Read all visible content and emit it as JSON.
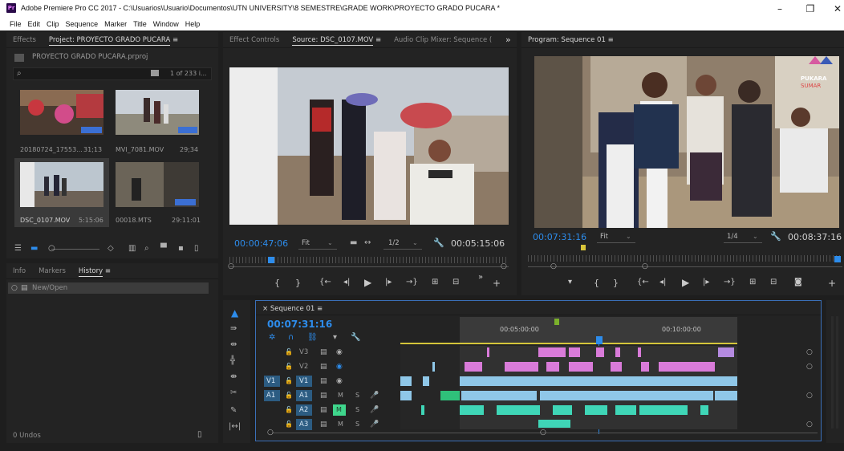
{
  "window": {
    "title": "Adobe Premiere Pro CC 2017 - C:\\Usuarios\\Usuario\\Documentos\\UTN UNIVERSITY\\8 SEMESTRE\\GRADE WORK\\PROYECTO GRADO PUCARA *",
    "app_icon": "Pr",
    "minimize": "–",
    "maximize": "❐",
    "close": "✕"
  },
  "menu": [
    "File",
    "Edit",
    "Clip",
    "Sequence",
    "Marker",
    "Title",
    "Window",
    "Help"
  ],
  "project_panel": {
    "tabs": [
      {
        "label": "Effects",
        "active": false
      },
      {
        "label": "Project: PROYECTO GRADO PUCARA",
        "active": true
      }
    ],
    "menu_icon": "≡",
    "project_file": "PROYECTO GRADO PUCARA.prproj",
    "search_placeholder": "",
    "item_count": "1 of 233 i...",
    "items": [
      {
        "name": "20180724_17553...",
        "duration": "31;13"
      },
      {
        "name": "MVI_7081.MOV",
        "duration": "29;34"
      },
      {
        "name": "DSC_0107.MOV",
        "duration": "5:15:06"
      },
      {
        "name": "00018.MTS",
        "duration": "29:11:01"
      }
    ]
  },
  "history_panel": {
    "tabs": [
      {
        "label": "Info",
        "active": false
      },
      {
        "label": "Markers",
        "active": false
      },
      {
        "label": "History",
        "active": true
      }
    ],
    "entries": [
      "New/Open"
    ],
    "undos": "0 Undos"
  },
  "source_panel": {
    "tabs": [
      {
        "label": "Effect Controls",
        "active": false
      },
      {
        "label": "Source: DSC_0107.MOV",
        "active": true
      },
      {
        "label": "Audio Clip Mixer: Sequence (",
        "active": false
      }
    ],
    "overflow": "»",
    "timecode": "00:00:47:06",
    "zoom": "Fit",
    "resolution": "1/2",
    "duration": "00:05:15:06"
  },
  "program_panel": {
    "tab": "Program: Sequence 01",
    "timecode": "00:07:31:16",
    "zoom": "Fit",
    "resolution": "1/4",
    "duration": "00:08:37:16",
    "logo_text": [
      "PUKARA",
      "SUMAR"
    ]
  },
  "timeline": {
    "sequence_tab": "Sequence 01",
    "timecode": "00:07:31:16",
    "ruler_labels": [
      "00:05:00:00",
      "00:10:00:00"
    ],
    "tracks": [
      {
        "name": "V3",
        "src": "",
        "kind": "video"
      },
      {
        "name": "V2",
        "src": "",
        "kind": "video"
      },
      {
        "name": "V1",
        "src": "V1",
        "kind": "video"
      },
      {
        "name": "A1",
        "src": "A1",
        "kind": "audio"
      },
      {
        "name": "A2",
        "src": "",
        "kind": "audio"
      },
      {
        "name": "A3",
        "src": "",
        "kind": "audio"
      }
    ],
    "mute_label": "M",
    "solo_label": "S"
  },
  "colors": {
    "accent_blue": "#2d8ceb",
    "clip_pink": "#d97bd9",
    "clip_blue": "#8fc7e8",
    "clip_audio_teal": "#3fd6b7",
    "clip_audio_green": "#2fc07a",
    "timecode_blue": "#2d8ceb"
  }
}
